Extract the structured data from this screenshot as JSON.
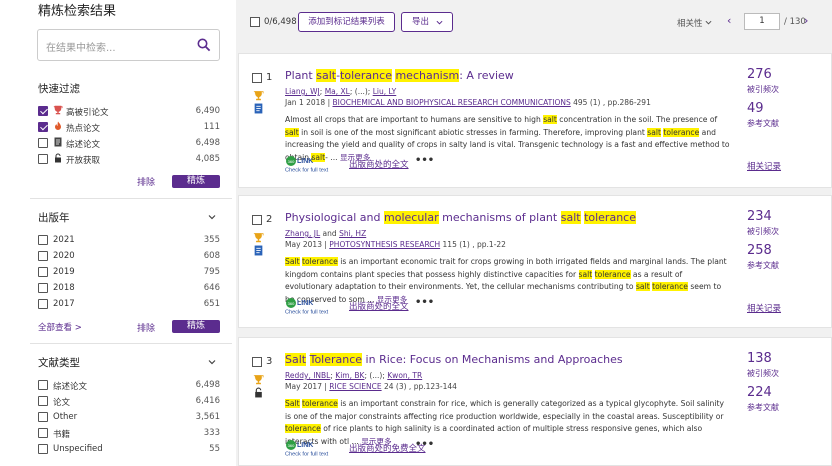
{
  "sidebar": {
    "title": "精炼检索结果",
    "search_placeholder": "在结果中检索...",
    "quick_filter": {
      "heading": "快速过滤",
      "items": [
        {
          "label": "高被引论文",
          "count": "6,490",
          "checked": true,
          "icon": "trophy-icon"
        },
        {
          "label": "热点论文",
          "count": "111",
          "checked": true,
          "icon": "flame-icon"
        },
        {
          "label": "综述论文",
          "count": "6,498",
          "checked": false,
          "icon": "document-icon"
        },
        {
          "label": "开放获取",
          "count": "4,085",
          "checked": false,
          "icon": "unlock-icon"
        }
      ],
      "exclude_label": "排除",
      "refine_label": "精炼"
    },
    "year": {
      "heading": "出版年",
      "items": [
        {
          "label": "2021",
          "count": "355"
        },
        {
          "label": "2020",
          "count": "608"
        },
        {
          "label": "2019",
          "count": "795"
        },
        {
          "label": "2018",
          "count": "646"
        },
        {
          "label": "2017",
          "count": "651"
        }
      ],
      "view_all": "全部查看 >",
      "exclude_label": "排除",
      "refine_label": "精炼"
    },
    "doc_type": {
      "heading": "文献类型",
      "items": [
        {
          "label": "综述论文",
          "count": "6,498"
        },
        {
          "label": "论文",
          "count": "6,416"
        },
        {
          "label": "Other",
          "count": "3,561"
        },
        {
          "label": "书籍",
          "count": "333"
        },
        {
          "label": "Unspecified",
          "count": "55"
        }
      ]
    }
  },
  "toolbar": {
    "selected": "0/6,498",
    "add_to_marked": "添加到标记结果列表",
    "export": "导出",
    "sort": "相关性",
    "page": "1",
    "total_pages": "/ 130"
  },
  "results": [
    {
      "num": "1",
      "title_segments": [
        [
          "Plant ",
          false
        ],
        [
          "salt",
          true
        ],
        [
          "-",
          false
        ],
        [
          "tolerance",
          true
        ],
        [
          " ",
          false
        ],
        [
          "mechanism",
          true
        ],
        [
          ": A review",
          false
        ]
      ],
      "authors_segments": [
        [
          "Liang, WJ",
          true
        ],
        [
          "; ",
          false
        ],
        [
          "Ma, XL",
          true
        ],
        [
          "; (...); ",
          false
        ],
        [
          "Liu, LY",
          true
        ]
      ],
      "date": "Jan 1 2018",
      "journal": "BIOCHEMICAL AND BIOPHYSICAL RESEARCH COMMUNICATIONS",
      "volume": " 495 (1) , pp.286-291",
      "abstract_segments": [
        [
          "Almost all crops that are important to humans are sensitive to high ",
          false
        ],
        [
          "salt",
          true
        ],
        [
          " concentration in the soil. The presence of ",
          false
        ],
        [
          "salt",
          true
        ],
        [
          " in soil is one of the most significant abiotic stresses in farming. Therefore, improving plant ",
          false
        ],
        [
          "salt",
          true
        ],
        [
          " ",
          false
        ],
        [
          "tolerance",
          true
        ],
        [
          " and increasing the yield and quality of crops in salty land is vital. Transgenic technology is a fast and effective method to obtain ",
          false
        ],
        [
          "salt",
          true
        ],
        [
          "- ... ",
          false
        ]
      ],
      "show_more": "显示更多",
      "full_text": "出版商处的全文",
      "cite_count": "276",
      "cite_label": "被引频次",
      "ref_count": "49",
      "ref_label": "参考文献",
      "related": "相关记录",
      "icons": [
        "trophy-icon",
        "document-icon"
      ]
    },
    {
      "num": "2",
      "title_segments": [
        [
          "Physiological and ",
          false
        ],
        [
          "molecular",
          true
        ],
        [
          " mechanisms of plant ",
          false
        ],
        [
          "salt",
          true
        ],
        [
          " ",
          false
        ],
        [
          "tolerance",
          true
        ]
      ],
      "authors_segments": [
        [
          "Zhang, JL",
          true
        ],
        [
          " and ",
          false
        ],
        [
          "Shi, HZ",
          true
        ]
      ],
      "date": "May 2013",
      "journal": "PHOTOSYNTHESIS RESEARCH",
      "volume": " 115 (1) , pp.1-22",
      "abstract_segments": [
        [
          "Salt",
          true
        ],
        [
          " ",
          false
        ],
        [
          "tolerance",
          true
        ],
        [
          " is an important economic trait for crops growing in both irrigated fields and marginal lands. The plant kingdom contains plant species that possess highly distinctive capacities for ",
          false
        ],
        [
          "salt",
          true
        ],
        [
          " ",
          false
        ],
        [
          "tolerance",
          true
        ],
        [
          " as a result of evolutionary adaptation to their environments. Yet, the cellular mechanisms contributing to ",
          false
        ],
        [
          "salt",
          true
        ],
        [
          " ",
          false
        ],
        [
          "tolerance",
          true
        ],
        [
          " seem to be conserved to som ... ",
          false
        ]
      ],
      "show_more": "显示更多",
      "full_text": "出版商处的全文",
      "cite_count": "234",
      "cite_label": "被引频次",
      "ref_count": "258",
      "ref_label": "参考文献",
      "related": "相关记录",
      "icons": [
        "trophy-icon",
        "document-icon"
      ]
    },
    {
      "num": "3",
      "title_segments": [
        [
          "Salt",
          true
        ],
        [
          " ",
          false
        ],
        [
          "Tolerance",
          true
        ],
        [
          " in Rice: Focus on Mechanisms and Approaches",
          false
        ]
      ],
      "authors_segments": [
        [
          "Reddy, INBL",
          true
        ],
        [
          "; ",
          false
        ],
        [
          "Kim, BK",
          true
        ],
        [
          "; (...); ",
          false
        ],
        [
          "Kwon, TR",
          true
        ]
      ],
      "date": "May 2017",
      "journal": "RICE SCIENCE",
      "volume": " 24 (3) , pp.123-144",
      "abstract_segments": [
        [
          "Salt",
          true
        ],
        [
          " ",
          false
        ],
        [
          "tolerance",
          true
        ],
        [
          " is an important constrain for rice, which is generally categorized as a typical glycophyte. Soil salinity is one of the major constraints affecting rice production worldwide, especially in the coastal areas. Susceptibility or ",
          false
        ],
        [
          "tolerance",
          true
        ],
        [
          " of rice plants to high salinity is a coordinated action of multiple stress responsive genes, which also interacts with otl ... ",
          false
        ]
      ],
      "show_more": "显示更多",
      "full_text": "出版商处的免费全文",
      "cite_count": "138",
      "cite_label": "被引频次",
      "ref_count": "224",
      "ref_label": "参考文献",
      "related": "",
      "icons": [
        "trophy-icon",
        "unlock-icon"
      ]
    }
  ],
  "link_logo": {
    "top": "LINK",
    "bottom": "Check for full text"
  },
  "colors": {
    "accent": "#5b2c8e",
    "highlight": "#fff200",
    "panel": "#f1f1f1"
  }
}
